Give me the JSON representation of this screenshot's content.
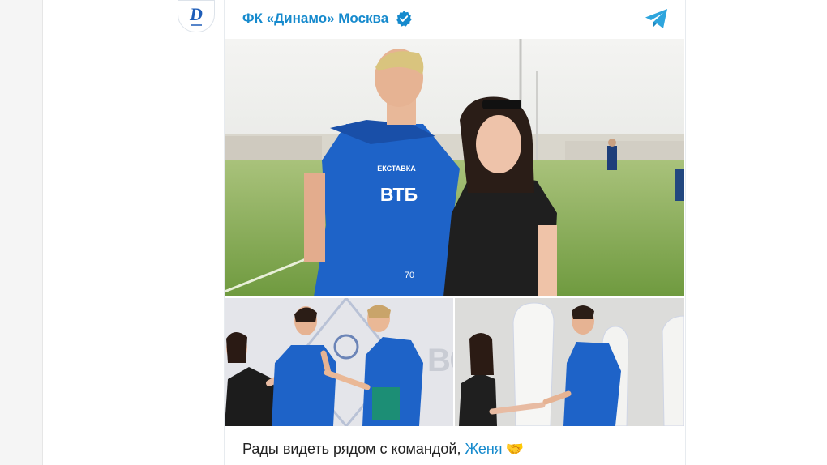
{
  "post": {
    "channel_name": "ФК «Динамо» Москва",
    "caption_text": "Рады видеть рядом с командой,",
    "caption_mention": "Женя",
    "caption_emoji": "🤝"
  },
  "photos": {
    "main_jersey_sponsor": "ВТБ",
    "main_jersey_sponsor_top": "ЕКСТАВКА",
    "main_jersey_number": "70"
  },
  "colors": {
    "accent": "#168acd",
    "dynamo_blue": "#1e63c8",
    "grass": "#7aa84a"
  },
  "icons": {
    "verified": "verified-badge-icon",
    "share": "telegram-share-icon"
  }
}
